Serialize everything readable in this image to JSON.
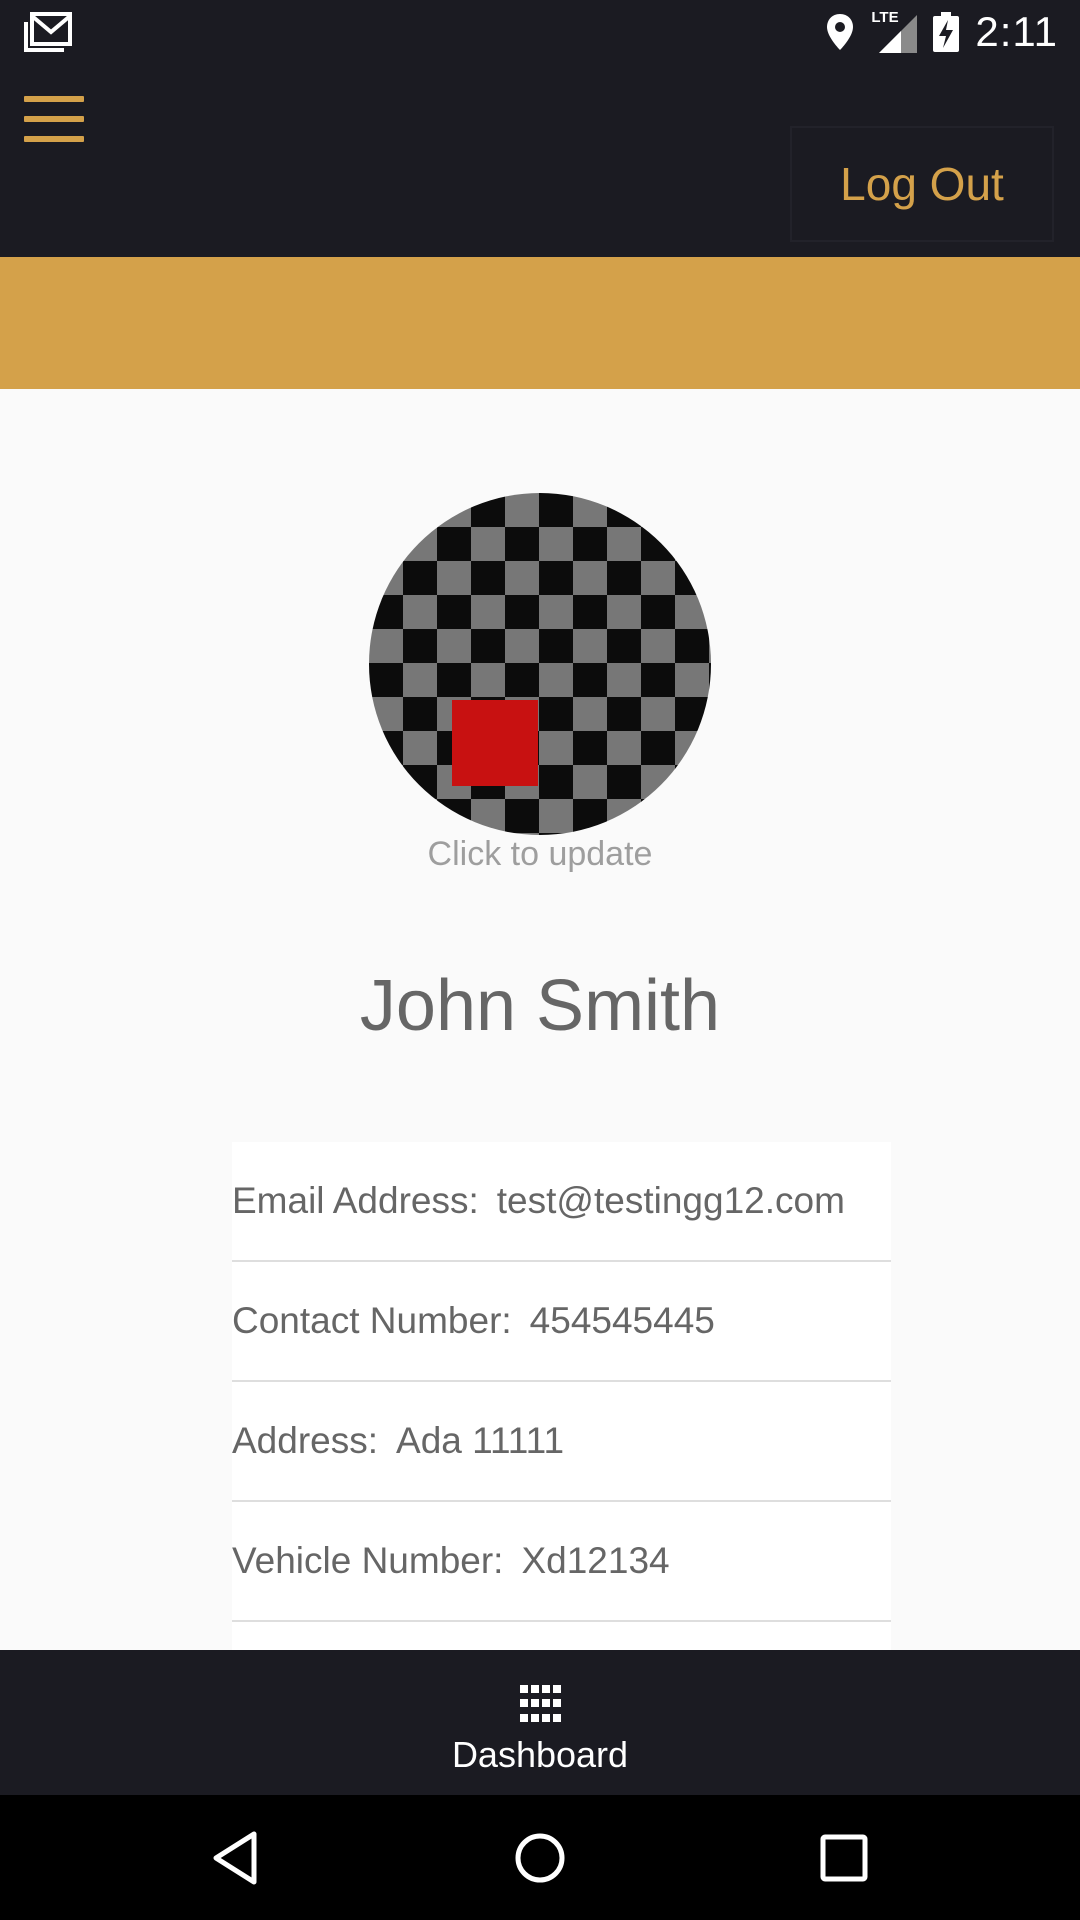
{
  "status_bar": {
    "time": "2:11",
    "network": "LTE",
    "icons": [
      "gmail-icon",
      "location-icon",
      "signal-icon",
      "battery-charging-icon"
    ]
  },
  "header": {
    "menu_icon": "hamburger-menu-icon",
    "logout_label": "Log Out"
  },
  "profile": {
    "avatar_caption": "Click to update",
    "name": "John Smith"
  },
  "details": [
    {
      "label": "Email Address:",
      "value": "test@testingg12.com"
    },
    {
      "label": "Contact Number:",
      "value": "454545445"
    },
    {
      "label": "Address:",
      "value": "Ada 11111"
    },
    {
      "label": "Vehicle Number:",
      "value": "Xd12134"
    }
  ],
  "bottom_nav": {
    "dashboard_label": "Dashboard",
    "dashboard_icon": "grid-icon"
  },
  "system_nav": {
    "icons": [
      "back-icon",
      "home-icon",
      "recents-icon"
    ]
  },
  "colors": {
    "accent": "#d4a14a",
    "bar_background": "#1b1b22",
    "avatar_highlight": "#c81111"
  }
}
